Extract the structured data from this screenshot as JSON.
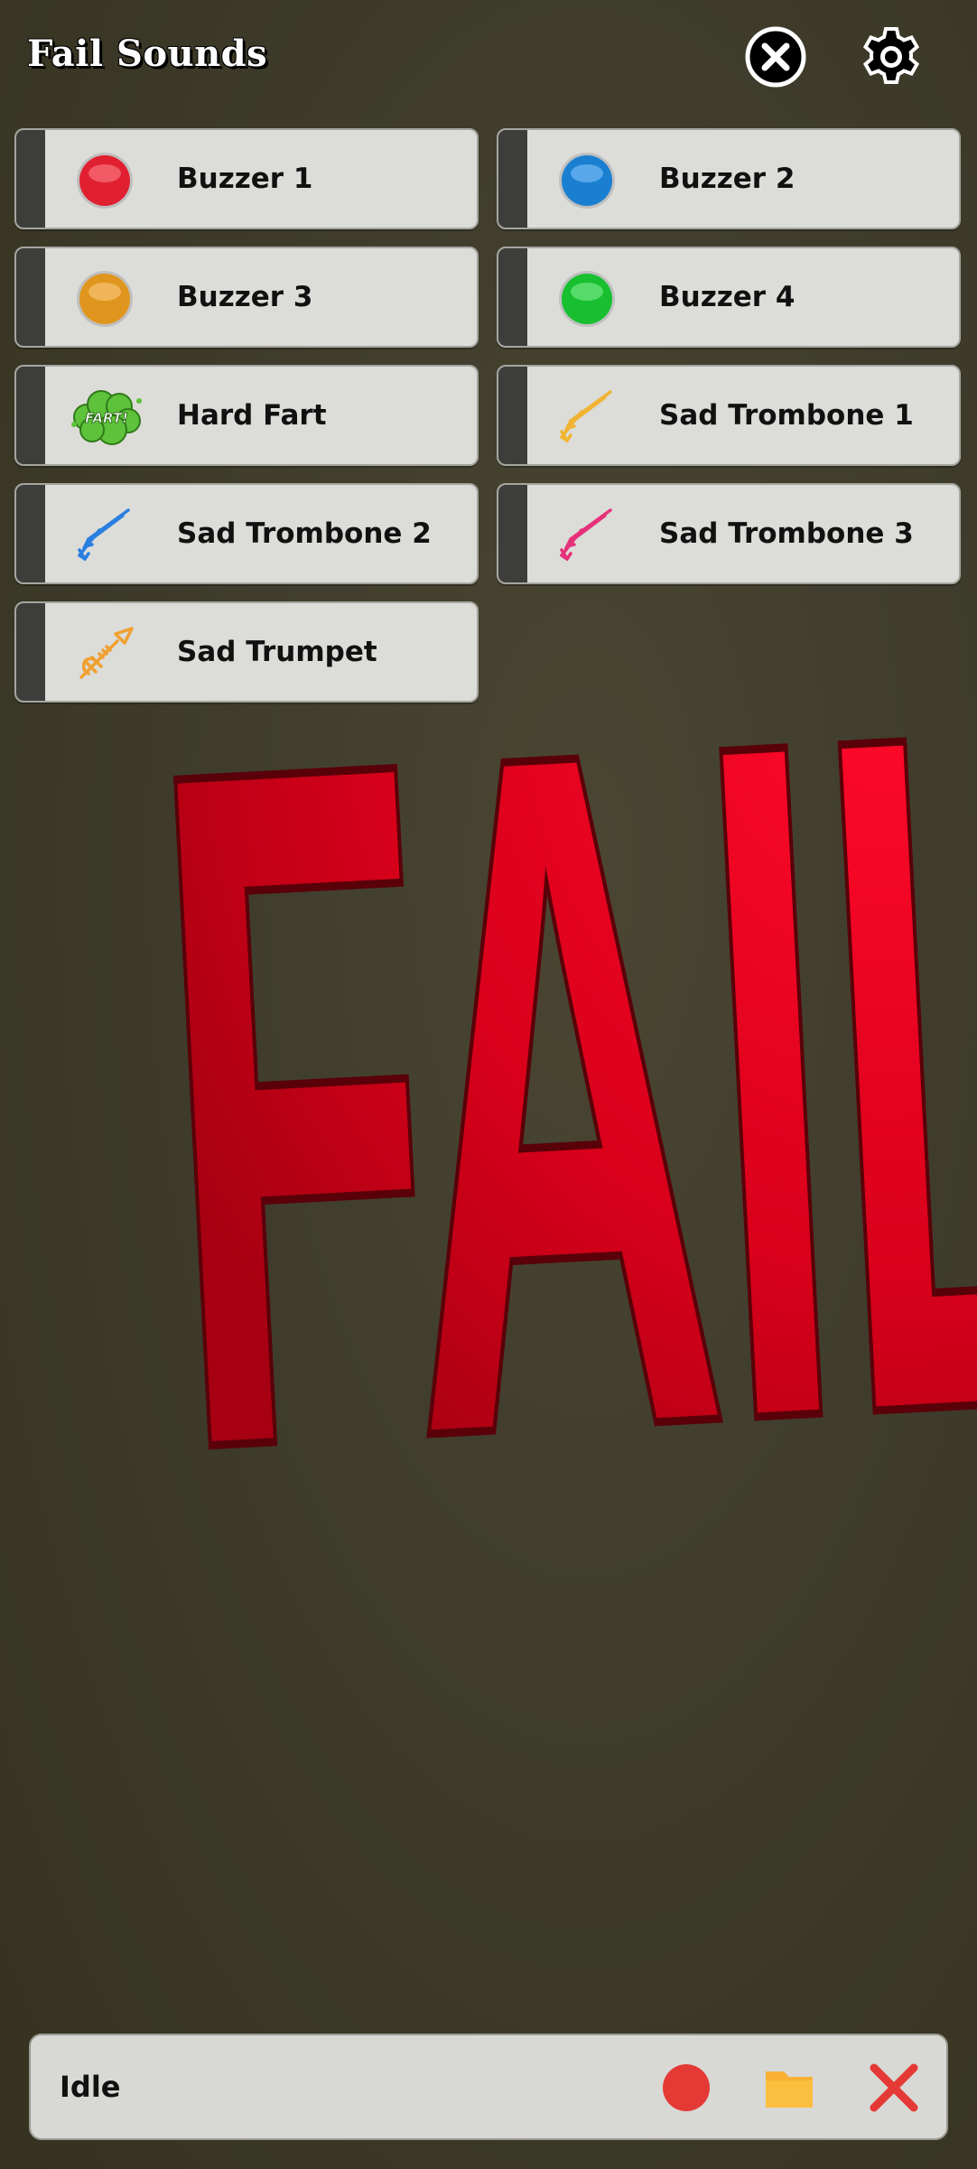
{
  "header": {
    "title": "Fail Sounds",
    "close_icon": "close-circle-icon",
    "settings_icon": "gear-icon"
  },
  "sounds": [
    {
      "label": "Buzzer 1",
      "icon": "red-buzzer-icon",
      "color": "#e02030"
    },
    {
      "label": "Buzzer 2",
      "icon": "blue-buzzer-icon",
      "color": "#1a7fd0"
    },
    {
      "label": "Buzzer 3",
      "icon": "orange-buzzer-icon",
      "color": "#e0961e"
    },
    {
      "label": "Buzzer 4",
      "icon": "green-buzzer-icon",
      "color": "#18c030"
    },
    {
      "label": "Hard Fart",
      "icon": "fart-cloud-icon",
      "color": "#5ec23a",
      "icon_text": "FART!"
    },
    {
      "label": "Sad Trombone 1",
      "icon": "trombone-icon",
      "color": "#f0b432"
    },
    {
      "label": "Sad Trombone 2",
      "icon": "trombone-icon",
      "color": "#2a7fe0"
    },
    {
      "label": "Sad Trombone 3",
      "icon": "trombone-icon",
      "color": "#e6307a"
    },
    {
      "label": "Sad Trumpet",
      "icon": "trumpet-icon",
      "color": "#f0a030"
    }
  ],
  "background_text": "FAIL",
  "status_bar": {
    "status": "Idle",
    "record_icon": "record-icon",
    "folder_icon": "folder-icon",
    "stop_icon": "stop-x-icon",
    "record_color": "#e53935",
    "folder_color": "#f9b233",
    "stop_color": "#e53935"
  }
}
